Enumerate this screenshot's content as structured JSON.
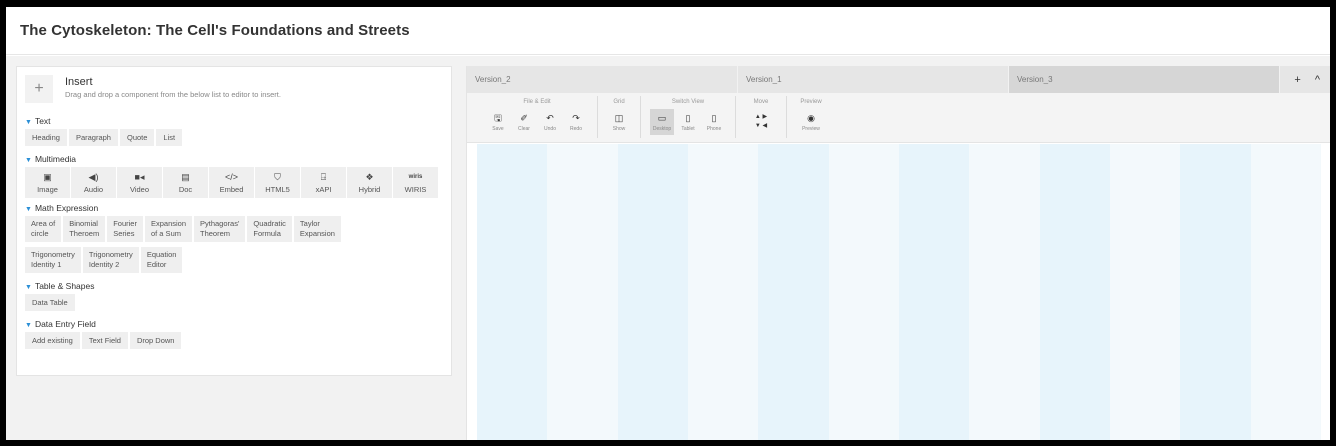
{
  "title": "The Cytoskeleton: The Cell's Foundations and Streets",
  "insert": {
    "plus": "+",
    "heading": "Insert",
    "hint": "Drag and drop a component from the below list to editor to insert."
  },
  "sections": {
    "text": {
      "title": "Text",
      "items": [
        "Heading",
        "Paragraph",
        "Quote",
        "List"
      ]
    },
    "multimedia": {
      "title": "Multimedia",
      "items": [
        {
          "label": "Image",
          "glyph": "▣"
        },
        {
          "label": "Audio",
          "glyph": "◀)"
        },
        {
          "label": "Video",
          "glyph": "■◂"
        },
        {
          "label": "Doc",
          "glyph": "▤"
        },
        {
          "label": "Embed",
          "glyph": "</>"
        },
        {
          "label": "HTML5",
          "glyph": "⛉"
        },
        {
          "label": "xAPI",
          "glyph": "⍈"
        },
        {
          "label": "Hybrid",
          "glyph": "❖"
        },
        {
          "label": "WIRIS",
          "glyph": "wiris"
        }
      ]
    },
    "math": {
      "title": "Math Expression",
      "row1": [
        [
          "Area of",
          "circle"
        ],
        [
          "Binomial",
          "Theroem"
        ],
        [
          "Fourier",
          "Series"
        ],
        [
          "Expansion",
          "of a Sum"
        ],
        [
          "Pythagoras'",
          "Theorem"
        ],
        [
          "Quadratic",
          "Formula"
        ],
        [
          "Taylor",
          "Expansion"
        ]
      ],
      "row2": [
        [
          "Trigonometry",
          "Identity 1"
        ],
        [
          "Trigonometry",
          "Identity 2"
        ],
        [
          "Equation",
          "Editor"
        ]
      ]
    },
    "table": {
      "title": "Table & Shapes",
      "items": [
        "Data Table"
      ]
    },
    "dataentry": {
      "title": "Data Entry Field",
      "items": [
        "Add existing",
        "Text Field",
        "Drop Down"
      ]
    }
  },
  "versions": [
    "Version_2",
    "Version_1",
    "Version_3"
  ],
  "version_actions": {
    "add": "+",
    "collapse": "^"
  },
  "toolbar": {
    "file_edit": "File & Edit",
    "grid": "Grid",
    "switch_view": "Switch View",
    "move": "Move",
    "preview": "Preview",
    "save": "Save",
    "clear": "Clear",
    "undo": "Undo",
    "redo": "Redo",
    "show": "Show",
    "desktop": "Desktop",
    "tablet": "Tablet",
    "phone": "Phone",
    "preview_btn": "Preview",
    "move_up": "▲  ▶",
    "move_down": "▼  ◀"
  },
  "icons": {
    "save": "🖫",
    "clear": "✐",
    "undo": "↶",
    "redo": "↷",
    "grid": "◫",
    "desktop": "▭",
    "tablet": "▯",
    "phone": "▯",
    "preview": "◉"
  },
  "colors": {
    "grid_column": "#e7f4fb",
    "grid_column_alt": "#f3f9fc",
    "accent": "#2b8fd6"
  }
}
